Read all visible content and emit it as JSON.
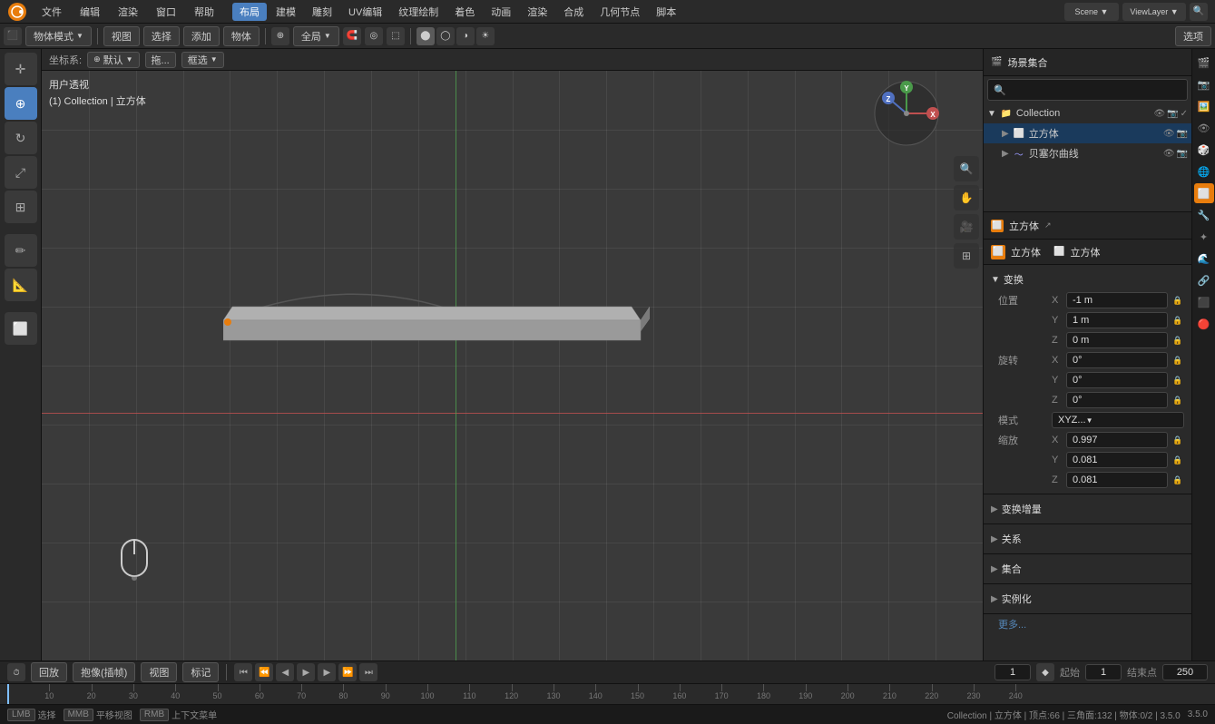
{
  "app": {
    "title": "Blender",
    "version": "3.5.0"
  },
  "top_menu": {
    "items": [
      "文件",
      "编辑",
      "渲染",
      "窗口",
      "帮助"
    ],
    "layout_tabs": [
      "布局",
      "建模",
      "雕刻",
      "UV编辑",
      "纹理绘制",
      "着色",
      "动画",
      "渲染",
      "合成",
      "几何节点",
      "脚本"
    ],
    "active_tab": "布局"
  },
  "toolbar": {
    "mode": "物体模式",
    "view_label": "视图",
    "select_label": "选择",
    "add_label": "添加",
    "object_label": "物体",
    "global_label": "全局",
    "options_label": "选项"
  },
  "coord_bar": {
    "coord_system": "默认",
    "drag_label": "拖...",
    "select_mode": "框选"
  },
  "viewport": {
    "view_mode": "用户透视",
    "breadcrumb": "(1) Collection | 立方体",
    "axis_gizmo_x": "X",
    "axis_gizmo_y": "Y",
    "axis_gizmo_z": "Z"
  },
  "right_header": {
    "scene_label": "场景集合"
  },
  "outliner": {
    "search_placeholder": "🔍",
    "collection_label": "Collection",
    "cube_label": "立方体",
    "bezier_label": "贝塞尔曲线"
  },
  "properties": {
    "object_name": "立方体",
    "data_name": "立方体",
    "transform_section": "变换",
    "location_label": "位置",
    "rotation_label": "旋转",
    "scale_label": "缩放",
    "mode_label": "模式",
    "delta_label": "变换增量",
    "relations_label": "关系",
    "collection_label": "集合",
    "instancing_label": "实例化",
    "more_label": "更多...",
    "loc_x": "-1 m",
    "loc_y": "1 m",
    "loc_z": "0 m",
    "rot_x": "0°",
    "rot_y": "0°",
    "rot_z": "0°",
    "scale_mode": "XYZ...",
    "scale_x": "0.997",
    "scale_y": "0.081",
    "scale_z": "0.081"
  },
  "timeline": {
    "playback_label": "回放",
    "sync_label": "抱像(插帧)",
    "view_label": "视图",
    "marker_label": "标记",
    "frame_current": "1",
    "start_label": "起始",
    "start_frame": "1",
    "end_label": "结束点",
    "end_frame": "250",
    "frame_ticks": [
      "10",
      "20",
      "30",
      "40",
      "50",
      "60",
      "70",
      "80",
      "90",
      "100",
      "110",
      "120",
      "130",
      "140",
      "150",
      "160",
      "170",
      "180",
      "190",
      "200",
      "210",
      "220",
      "230",
      "240"
    ]
  },
  "status_bar": {
    "select_label": "选择",
    "pan_label": "平移视图",
    "context_label": "上下文菜单",
    "info": "Collection | 立方体 | 顶点:66 | 三角面:132 | 物体:0/2 | 3.5.0",
    "vertices": "顶点:66",
    "triangles": "三角面:132",
    "objects": "物体:0/2"
  },
  "side_icons": {
    "items": [
      "🎬",
      "⚙️",
      "🖼️",
      "🌀",
      "🎲",
      "💡",
      "🟠",
      "🔧",
      "📷",
      "🌊",
      "🔲",
      "💫"
    ]
  }
}
